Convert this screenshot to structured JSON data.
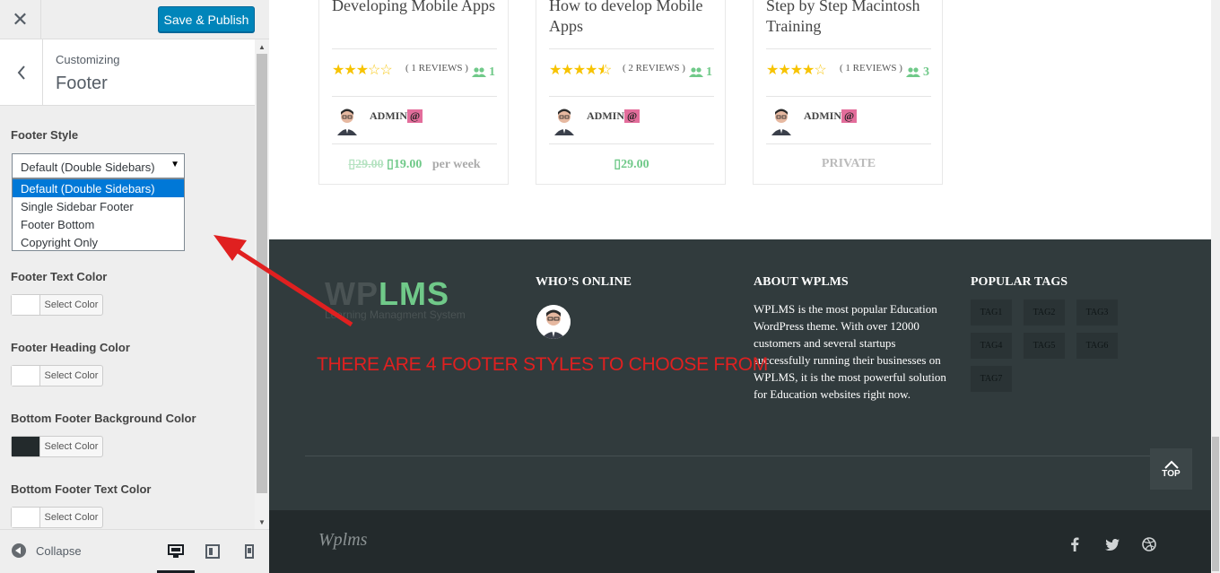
{
  "customizer": {
    "close_label": "✕",
    "save_label": "Save & Publish",
    "breadcrumb_parent": "Customizing",
    "section_title": "Footer",
    "footer_style": {
      "label": "Footer Style",
      "selected": "Default (Double Sidebars)",
      "options": [
        "Default (Double Sidebars)",
        "Single Sidebar Footer",
        "Footer Bottom",
        "Copyright Only"
      ]
    },
    "color_controls": [
      {
        "label": "Footer Text Color",
        "button": "Select Color",
        "swatch": "#ffffff"
      },
      {
        "label": "Footer Heading Color",
        "button": "Select Color",
        "swatch": "#ffffff"
      },
      {
        "label": "Bottom Footer Background Color",
        "button": "Select Color",
        "swatch": "#232a2c"
      },
      {
        "label": "Bottom Footer Text Color",
        "button": "Select Color",
        "swatch": "#ffffff"
      }
    ],
    "collapse_label": "Collapse"
  },
  "courses": [
    {
      "title": "Developing Mobile Apps",
      "reviews": "( 1 REVIEWS )",
      "rating": 3,
      "students": "1",
      "instructor": "ADMIN",
      "badge": "@",
      "old_price": "29.00",
      "price": "19.00",
      "per": "per week"
    },
    {
      "title": "How to develop Mobile Apps",
      "reviews": "( 2 REVIEWS )",
      "rating": 4.5,
      "students": "1",
      "instructor": "ADMIN",
      "badge": "@",
      "price": "29.00"
    },
    {
      "title": "Step by Step Macintosh Training",
      "reviews": "( 1 REVIEWS )",
      "rating": 4,
      "students": "3",
      "instructor": "ADMIN",
      "badge": "@",
      "price": "PRIVATE"
    }
  ],
  "footer": {
    "logo_wp": "WP",
    "logo_lms": "LMS",
    "logo_tagline": "Learning Managment System",
    "whos_online_title": "WHO’S ONLINE",
    "about_title": "ABOUT WPLMS",
    "about_text": "WPLMS is the most popular Education WordPress theme. With over 12000 customers and several startups successfully running their businesses on WPLMS, it is the most powerful solution for Education websites right now.",
    "tags_title": "POPULAR TAGS",
    "tags": [
      "TAG1",
      "TAG2",
      "TAG3",
      "TAG4",
      "TAG5",
      "TAG6",
      "TAG7"
    ],
    "annotation": "THERE ARE 4 FOOTER STYLES TO CHOOSE FROM",
    "top_label": "TOP",
    "signature": "Wplms"
  },
  "colors": {
    "accent": "#70c989",
    "primary_button": "#0085ba",
    "footer_bg": "#313b3d",
    "bottom_footer_bg": "#232a2c",
    "annotation": "#e02020"
  }
}
